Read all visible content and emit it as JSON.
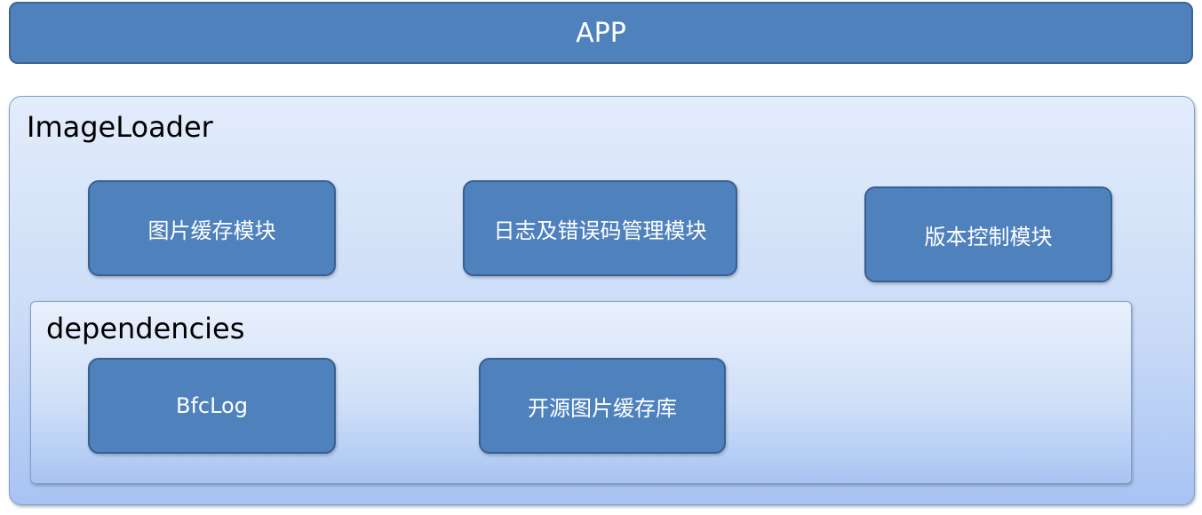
{
  "app": {
    "label": "APP"
  },
  "imageloader": {
    "title": "ImageLoader",
    "modules": [
      {
        "label": "图片缓存模块"
      },
      {
        "label": "日志及错误码管理模块"
      },
      {
        "label": "版本控制模块"
      }
    ]
  },
  "dependencies": {
    "title": "dependencies",
    "modules": [
      {
        "label": "BfcLog"
      },
      {
        "label": "开源图片缓存库"
      }
    ]
  },
  "colors": {
    "module_fill": "#4f81bd",
    "module_border": "#38608f",
    "container_gradient_top": "#e3ecfb",
    "container_gradient_bottom": "#a8c3f3"
  }
}
